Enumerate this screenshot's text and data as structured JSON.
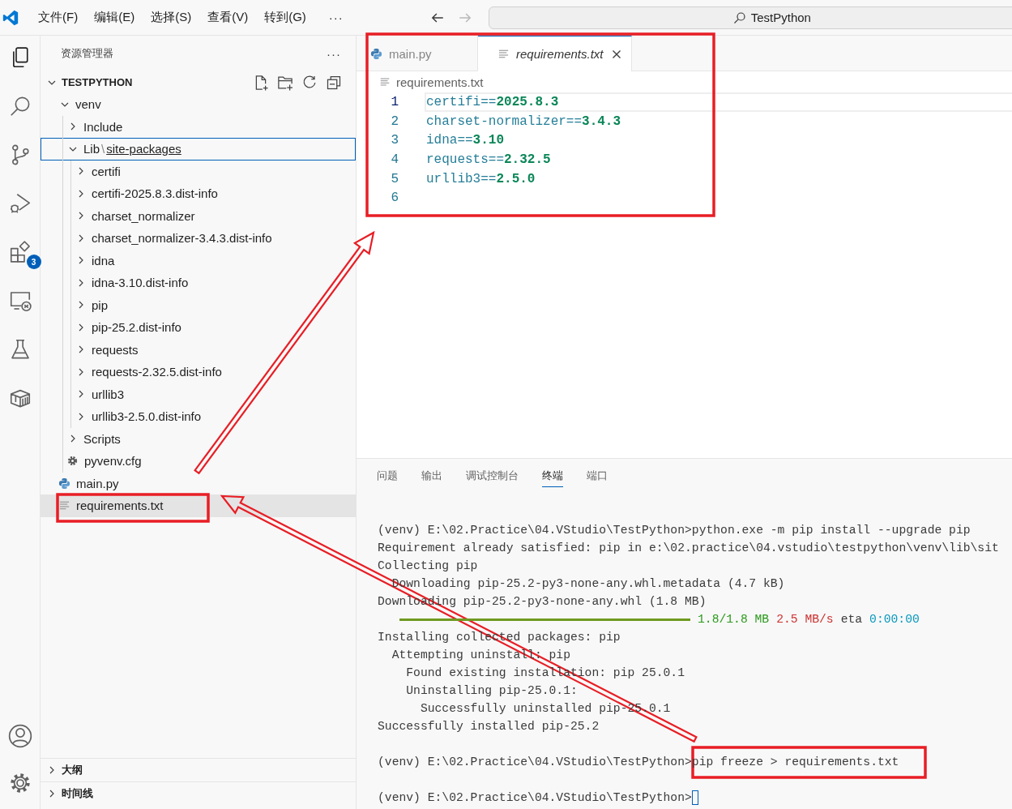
{
  "title_bar": {
    "menus": [
      "文件(F)",
      "编辑(E)",
      "选择(S)",
      "查看(V)",
      "转到(G)"
    ],
    "more": "···",
    "nav": [
      {
        "kind": "back",
        "disabled": false
      },
      {
        "kind": "forward",
        "disabled": true
      }
    ],
    "command_center": {
      "label": "TestPython"
    }
  },
  "activity_bar": {
    "items": [
      {
        "kind": "explorer",
        "selected": true
      },
      {
        "kind": "search",
        "selected": false
      },
      {
        "kind": "source-control",
        "selected": false
      },
      {
        "kind": "run-debug",
        "selected": false
      },
      {
        "kind": "extensions",
        "selected": false,
        "badge": "3"
      },
      {
        "kind": "remote",
        "selected": false
      },
      {
        "kind": "testing",
        "selected": false
      },
      {
        "kind": "containers",
        "selected": false
      }
    ],
    "bottom": [
      {
        "kind": "account",
        "selected": false
      },
      {
        "kind": "settings",
        "selected": false
      }
    ]
  },
  "sidebar": {
    "title": "资源管理器",
    "more": "···",
    "sections": [
      {
        "title": "TESTPYTHON",
        "expanded": true,
        "tree": [
          {
            "label": "venv",
            "kind": "folder",
            "expanded": true,
            "selected": false,
            "focused": false,
            "children": [
              {
                "label": "Include",
                "kind": "folder",
                "expanded": false,
                "selected": false,
                "focused": false
              },
              {
                "segments": [
                  "Lib",
                  "site-packages"
                ],
                "separator": "\\",
                "kind": "folder",
                "expanded": true,
                "selected": false,
                "focused": true,
                "children": [
                  {
                    "label": "certifi",
                    "kind": "folder",
                    "expanded": false,
                    "selected": false,
                    "focused": false
                  },
                  {
                    "label": "certifi-2025.8.3.dist-info",
                    "kind": "folder",
                    "expanded": false,
                    "selected": false,
                    "focused": false
                  },
                  {
                    "label": "charset_normalizer",
                    "kind": "folder",
                    "expanded": false,
                    "selected": false,
                    "focused": false
                  },
                  {
                    "label": "charset_normalizer-3.4.3.dist-info",
                    "kind": "folder",
                    "expanded": false,
                    "selected": false,
                    "focused": false
                  },
                  {
                    "label": "idna",
                    "kind": "folder",
                    "expanded": false,
                    "selected": false,
                    "focused": false
                  },
                  {
                    "label": "idna-3.10.dist-info",
                    "kind": "folder",
                    "expanded": false,
                    "selected": false,
                    "focused": false
                  },
                  {
                    "label": "pip",
                    "kind": "folder",
                    "expanded": false,
                    "selected": false,
                    "focused": false
                  },
                  {
                    "label": "pip-25.2.dist-info",
                    "kind": "folder",
                    "expanded": false,
                    "selected": false,
                    "focused": false
                  },
                  {
                    "label": "requests",
                    "kind": "folder",
                    "expanded": false,
                    "selected": false,
                    "focused": false
                  },
                  {
                    "label": "requests-2.32.5.dist-info",
                    "kind": "folder",
                    "expanded": false,
                    "selected": false,
                    "focused": false
                  },
                  {
                    "label": "urllib3",
                    "kind": "folder",
                    "expanded": false,
                    "selected": false,
                    "focused": false
                  },
                  {
                    "label": "urllib3-2.5.0.dist-info",
                    "kind": "folder",
                    "expanded": false,
                    "selected": false,
                    "focused": false
                  }
                ]
              },
              {
                "label": "Scripts",
                "kind": "folder",
                "expanded": false,
                "selected": false,
                "focused": false
              },
              {
                "label": "pyvenv.cfg",
                "kind": "config",
                "selected": false,
                "focused": false
              }
            ]
          },
          {
            "label": "main.py",
            "kind": "python",
            "selected": false,
            "focused": false
          },
          {
            "label": "requirements.txt",
            "kind": "text",
            "selected": true,
            "focused": false
          }
        ]
      },
      {
        "title": "大纲",
        "expanded": false
      },
      {
        "title": "时间线",
        "expanded": false
      }
    ]
  },
  "editor": {
    "tabs": [
      {
        "label": "main.py",
        "kind": "python",
        "selected": false,
        "preview": false,
        "closable": false
      },
      {
        "label": "requirements.txt",
        "kind": "text",
        "selected": true,
        "preview": true,
        "closable": true
      }
    ],
    "breadcrumb": {
      "kind": "text",
      "label": "requirements.txt"
    },
    "lines": [
      {
        "number": "1",
        "package": "certifi",
        "operator": "==",
        "version": "2025.8.3",
        "current": true
      },
      {
        "number": "2",
        "package": "charset-normalizer",
        "operator": "==",
        "version": "3.4.3",
        "current": false
      },
      {
        "number": "3",
        "package": "idna",
        "operator": "==",
        "version": "3.10",
        "current": false
      },
      {
        "number": "4",
        "package": "requests",
        "operator": "==",
        "version": "2.32.5",
        "current": false
      },
      {
        "number": "5",
        "package": "urllib3",
        "operator": "==",
        "version": "2.5.0",
        "current": false
      },
      {
        "number": "6",
        "current": false
      }
    ]
  },
  "panel": {
    "tabs": [
      {
        "label": "问题",
        "selected": false
      },
      {
        "label": "输出",
        "selected": false
      },
      {
        "label": "调试控制台",
        "selected": false
      },
      {
        "label": "终端",
        "selected": true
      },
      {
        "label": "端口",
        "selected": false
      }
    ],
    "terminal": [
      {
        "kind": "prompt",
        "prompt": "(venv) E:\\02.Practice\\04.VStudio\\TestPython>",
        "command": "python.exe -m pip install --upgrade pip",
        "cursor": false
      },
      {
        "kind": "output",
        "text": "Requirement already satisfied: pip in e:\\02.practice\\04.vstudio\\testpython\\venv\\lib\\sit"
      },
      {
        "kind": "output",
        "text": "Collecting pip"
      },
      {
        "kind": "output",
        "text": "  Downloading pip-25.2-py3-none-any.whl.metadata (4.7 kB)"
      },
      {
        "kind": "output",
        "text": "Downloading pip-25.2-py3-none-any.whl (1.8 MB)"
      },
      {
        "kind": "progress",
        "level": 1,
        "amount": "1.8/1.8 MB",
        "speed": "2.5 MB/s",
        "eta_label": "eta",
        "eta": "0:00:00"
      },
      {
        "kind": "output",
        "text": "Installing collected packages: pip"
      },
      {
        "kind": "output",
        "text": "  Attempting uninstall: pip"
      },
      {
        "kind": "output",
        "text": "    Found existing installation: pip 25.0.1"
      },
      {
        "kind": "output",
        "text": "    Uninstalling pip-25.0.1:"
      },
      {
        "kind": "output",
        "text": "      Successfully uninstalled pip-25.0.1"
      },
      {
        "kind": "output",
        "text": "Successfully installed pip-25.2"
      },
      {
        "kind": "blank"
      },
      {
        "kind": "prompt",
        "prompt": "(venv) E:\\02.Practice\\04.VStudio\\TestPython>",
        "command": "pip freeze > requirements.txt",
        "cursor": false
      },
      {
        "kind": "blank"
      },
      {
        "kind": "prompt",
        "prompt": "(venv) E:\\02.Practice\\04.VStudio\\TestPython>",
        "cursor": true
      }
    ]
  }
}
